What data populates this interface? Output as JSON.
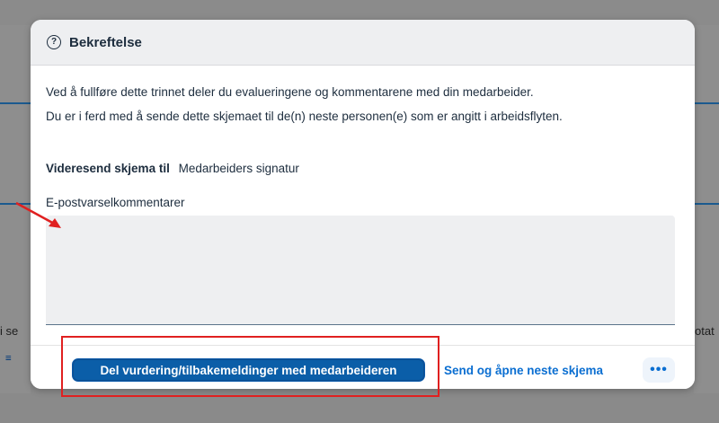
{
  "dialog": {
    "title": "Bekreftelse",
    "icon": "help-icon",
    "info_line1": "Ved å fullføre dette trinnet deler du evalueringene og kommentarene med din medarbeider.",
    "info_line2": "Du er i ferd med å sende dette skjemaet til de(n) neste personen(e) som er angitt i arbeidsflyten.",
    "forward_label": "Videresend skjema til",
    "forward_value": "Medarbeiders signatur",
    "comment_label": "E-postvarselkommentarer",
    "comment_value": "",
    "primary_button": "Del vurdering/tilbakemeldinger med medarbeideren",
    "secondary_button": "Send og åpne neste skjema",
    "more_button": "•••"
  },
  "background": {
    "left_fragment": "i se",
    "right_fragment": "otat"
  },
  "colors": {
    "primary": "#0b5ea8",
    "link": "#0a6ed1",
    "annotation": "#e02020"
  }
}
